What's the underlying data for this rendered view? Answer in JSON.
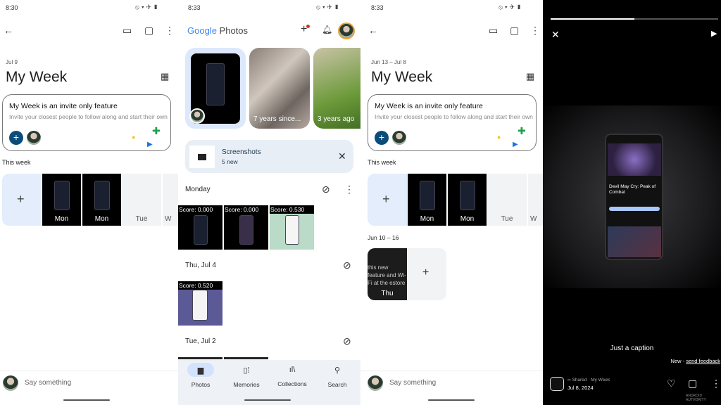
{
  "panel1": {
    "status_time": "8:30",
    "date_range": "Jul 9",
    "title": "My Week",
    "invite_card": {
      "title": "My Week is an invite only feature",
      "body": "Invite your closest people to follow along and start their own"
    },
    "section_this_week": "This week",
    "day_tiles": [
      "Mon",
      "Mon",
      "Tue",
      "W"
    ],
    "composer_placeholder": "Say something"
  },
  "panel2": {
    "status_time": "8:33",
    "logo_google": "Google",
    "logo_photos": "Photos",
    "memories": [
      "7 years since...",
      "3 years ago"
    ],
    "screenshots_card": {
      "title": "Screenshots",
      "subtitle": "5 new"
    },
    "groups": [
      {
        "label": "Monday",
        "scores": [
          "Score: 0.000",
          "Score: 0.000",
          "Score: 0.530"
        ]
      },
      {
        "label": "Thu, Jul 4",
        "scores": [
          "Score: 0.520"
        ]
      },
      {
        "label": "Tue, Jul 2",
        "scores": []
      }
    ],
    "bottom_nav": [
      {
        "label": "Photos",
        "icon": "photo-icon",
        "active": true
      },
      {
        "label": "Memories",
        "icon": "memories-icon"
      },
      {
        "label": "Collections",
        "icon": "collections-icon"
      },
      {
        "label": "Search",
        "icon": "search-icon"
      }
    ]
  },
  "panel3": {
    "status_time": "8:33",
    "date_range": "Jun 13 – Jul 8",
    "title": "My Week",
    "invite_card": {
      "title": "My Week is an invite only feature",
      "body": "Invite your closest people to follow along and start their own"
    },
    "section_this_week": "This week",
    "day_tiles": [
      "Mon",
      "Mon",
      "Tue",
      "W"
    ],
    "section_past": "Jun 10 – 16",
    "past_tile_text": "this new feature and Wi-Fi at the estore your devi",
    "past_tile_day": "Thu",
    "composer_placeholder": "Say something"
  },
  "panel4": {
    "story_progress": 0.5,
    "inner_screenshot_title": "Devil May Cry: Peak of Combat",
    "caption": "Just a caption",
    "feedback_prefix": "New - ",
    "feedback_link": "send feedback",
    "shared_label": "Shared · My Week",
    "date": "Jul 8, 2024",
    "watermark": "ANDROID AUTHORITY"
  },
  "colors": {
    "accent_blue": "#0b57d0",
    "invite_plus": "#0b4d7a",
    "tile_blue": "#e3edfb",
    "nav_bg": "#eef2f7"
  }
}
